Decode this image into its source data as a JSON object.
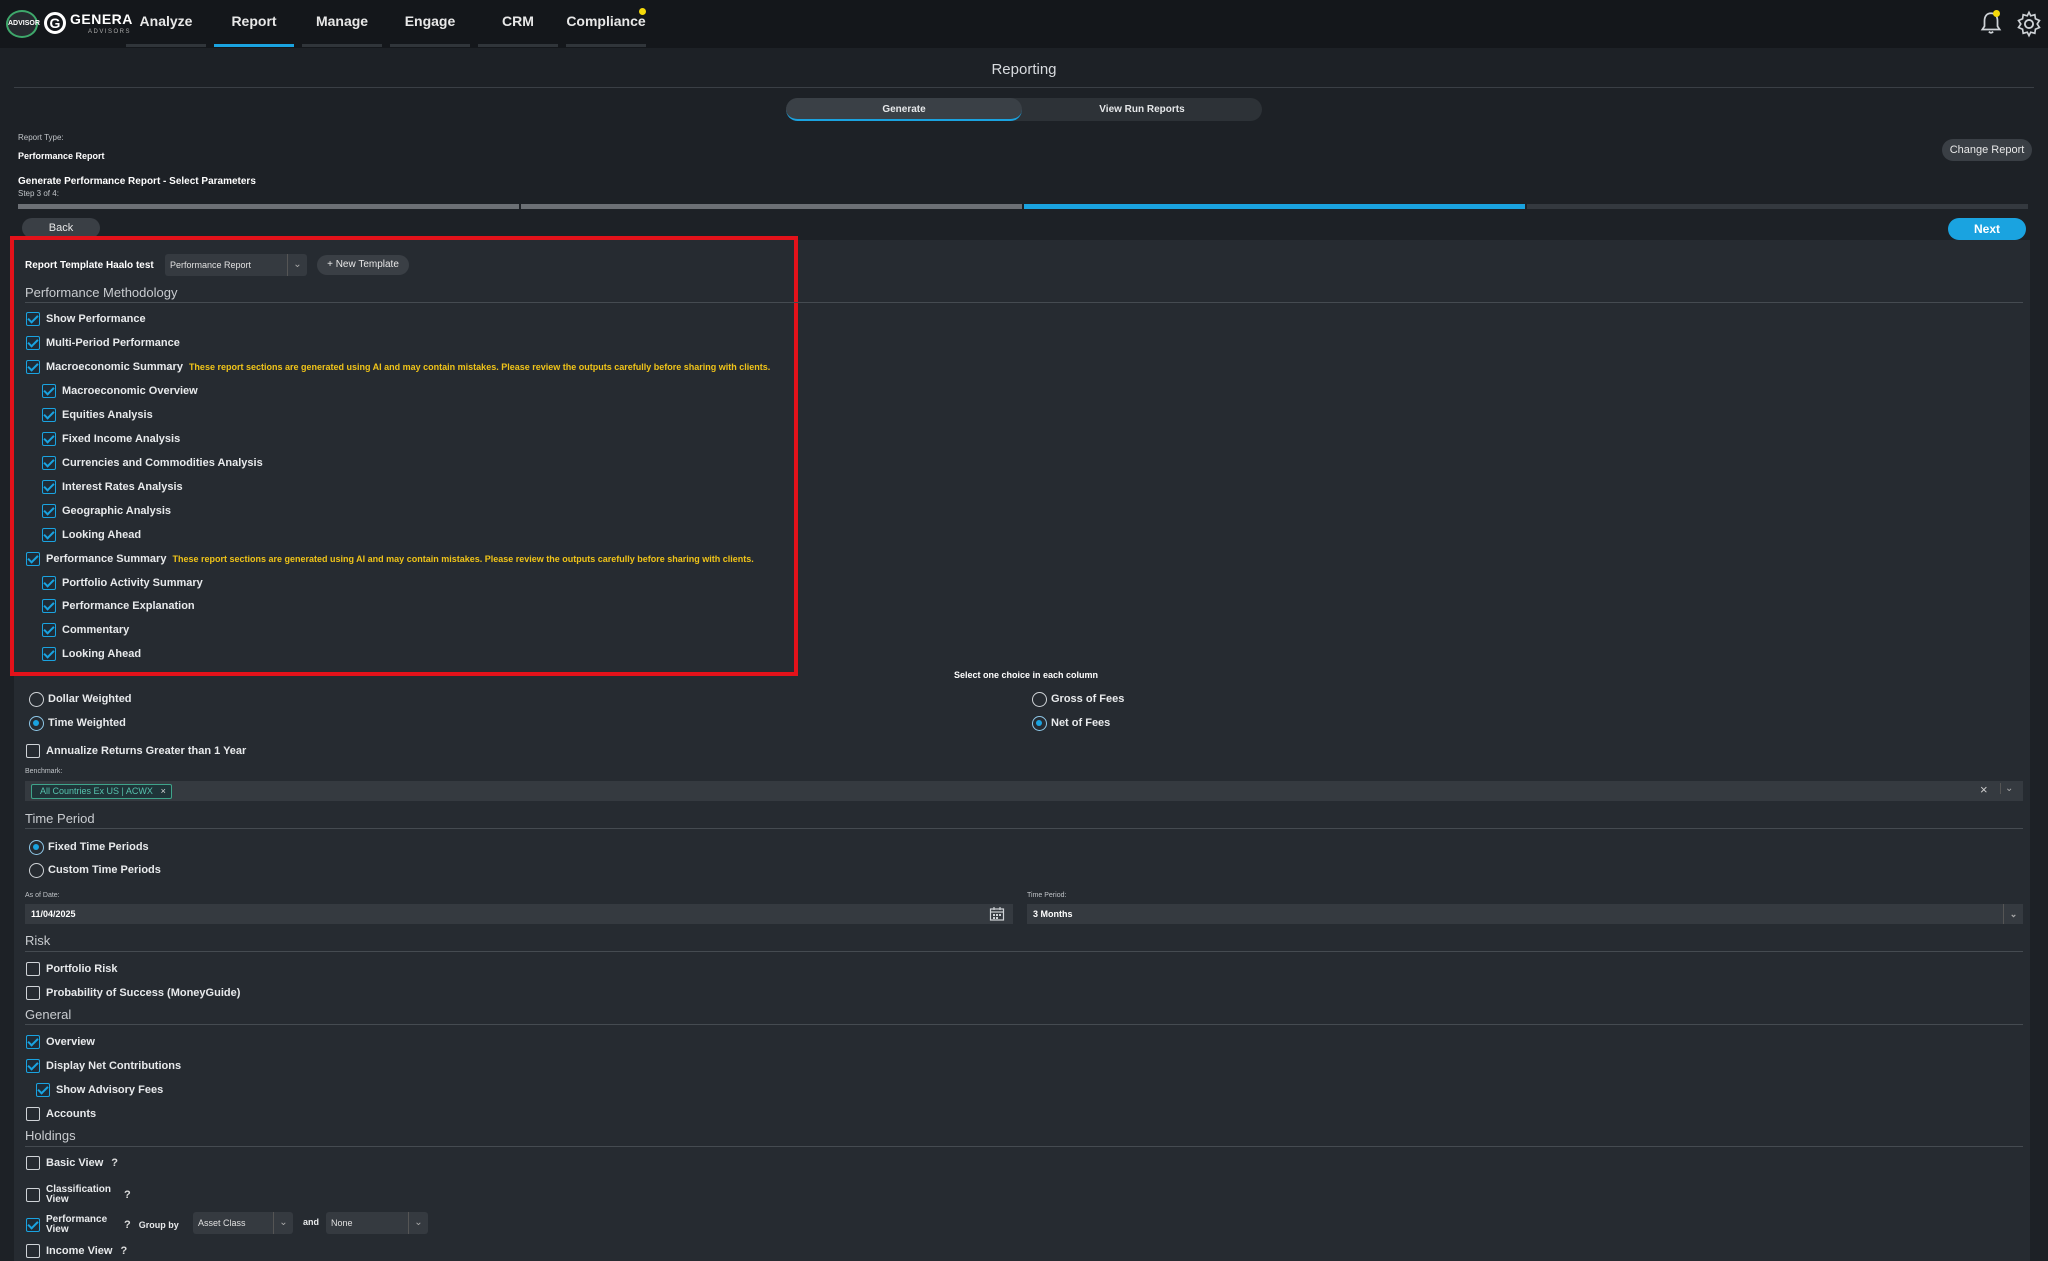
{
  "topbar": {
    "advisor_logo": "ADVISOR",
    "brand_name": "GENERA",
    "brand_sub": "ADVISORS",
    "nav": [
      "Analyze",
      "Report",
      "Manage",
      "Engage",
      "CRM",
      "Compliance"
    ],
    "active_nav": "Report"
  },
  "page_title": "Reporting",
  "tabs": {
    "generate": "Generate",
    "view_run": "View Run Reports"
  },
  "report_type": {
    "label": "Report Type:",
    "value": "Performance Report",
    "change_button": "Change Report"
  },
  "wizard": {
    "title": "Generate Performance Report - Select Parameters",
    "step": "Step 3 of 4:",
    "back": "Back",
    "next": "Next",
    "progress": {
      "current_step": 3,
      "total_steps": 4
    }
  },
  "template": {
    "label": "Report Template Haalo test",
    "selected": "Performance Report",
    "new_button": "+ New Template"
  },
  "performance_methodology": {
    "heading": "Performance Methodology",
    "items": [
      {
        "label": "Show Performance",
        "checked": true
      },
      {
        "label": "Multi-Period Performance",
        "checked": true
      },
      {
        "label": "Macroeconomic Summary",
        "checked": true,
        "warning": "These report sections are generated using AI and may contain mistakes. Please review the outputs carefully before sharing with clients."
      },
      {
        "label": "Macroeconomic Overview",
        "checked": true
      },
      {
        "label": "Equities Analysis",
        "checked": true
      },
      {
        "label": "Fixed Income Analysis",
        "checked": true
      },
      {
        "label": "Currencies and Commodities Analysis",
        "checked": true
      },
      {
        "label": "Interest Rates Analysis",
        "checked": true
      },
      {
        "label": "Geographic Analysis",
        "checked": true
      },
      {
        "label": "Looking Ahead",
        "checked": true
      },
      {
        "label": "Performance Summary",
        "checked": true,
        "warning": "These report sections are generated using AI and may contain mistakes. Please review the outputs carefully before sharing with clients."
      },
      {
        "label": "Portfolio Activity Summary",
        "checked": true
      },
      {
        "label": "Performance Explanation",
        "checked": true
      },
      {
        "label": "Commentary",
        "checked": true
      },
      {
        "label": "Looking Ahead",
        "checked": true
      }
    ],
    "choice_hint": "Select one choice in each column",
    "weighting": [
      {
        "label": "Dollar Weighted",
        "selected": false
      },
      {
        "label": "Time Weighted",
        "selected": true
      }
    ],
    "fees": [
      {
        "label": "Gross of Fees",
        "selected": false
      },
      {
        "label": "Net of Fees",
        "selected": true
      }
    ],
    "annualize": {
      "label": "Annualize Returns Greater than 1 Year",
      "checked": false
    }
  },
  "benchmark": {
    "label": "Benchmark:",
    "chip": "All Countries Ex US | ACWX"
  },
  "time_period": {
    "heading": "Time Period",
    "options": [
      {
        "label": "Fixed Time Periods",
        "selected": true
      },
      {
        "label": "Custom Time Periods",
        "selected": false
      }
    ],
    "as_of_label": "As of Date:",
    "as_of_value": "11/04/2025",
    "period_label": "Time Period:",
    "period_value": "3 Months"
  },
  "risk": {
    "heading": "Risk",
    "items": [
      {
        "label": "Portfolio Risk",
        "checked": false
      },
      {
        "label": "Probability of Success (MoneyGuide)",
        "checked": false
      }
    ]
  },
  "general": {
    "heading": "General",
    "items": [
      {
        "label": "Overview",
        "checked": true
      },
      {
        "label": "Display Net Contributions",
        "checked": true
      },
      {
        "label": "Show Advisory Fees",
        "checked": true
      },
      {
        "label": "Accounts",
        "checked": false
      }
    ]
  },
  "holdings": {
    "heading": "Holdings",
    "basic": {
      "label": "Basic View",
      "checked": false
    },
    "classification": {
      "label1": "Classification",
      "label2": "View",
      "checked": false
    },
    "performance": {
      "label1": "Performance",
      "label2": "View",
      "checked": true,
      "group_by": "Group by",
      "group1": "Asset Class",
      "and": "and",
      "group2": "None"
    },
    "income": {
      "label": "Income View",
      "checked": false
    },
    "help": "?"
  },
  "colors": {
    "accent": "#1aa3e0",
    "warning": "#f0c419",
    "highlight_box": "#e3121a",
    "notification_dot": "#f5d90a"
  }
}
